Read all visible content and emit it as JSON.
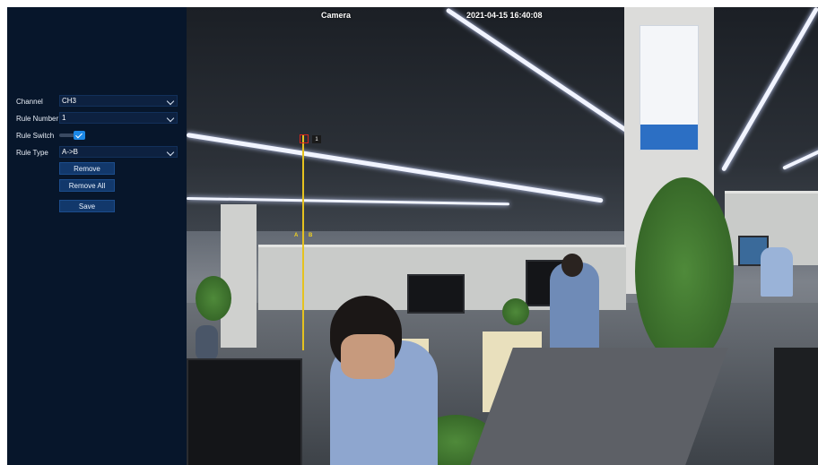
{
  "osd": {
    "camera_name": "Camera",
    "timestamp": "2021-04-15 16:40:08"
  },
  "panel": {
    "channel": {
      "label": "Channel",
      "value": "CH3"
    },
    "rule_number": {
      "label": "Rule Number",
      "value": "1"
    },
    "rule_switch": {
      "label": "Rule Switch",
      "checked": true
    },
    "rule_type": {
      "label": "Rule Type",
      "value": "A->B"
    },
    "remove_label": "Remove",
    "remove_all_label": "Remove All",
    "save_label": "Save"
  },
  "overlay": {
    "rule_tag": "1",
    "point_a": "A",
    "point_b": "B"
  },
  "colors": {
    "panel_bg": "#07162b",
    "accent": "#1c88e6",
    "button": "#12386b",
    "rule_line": "#e5c21f"
  }
}
